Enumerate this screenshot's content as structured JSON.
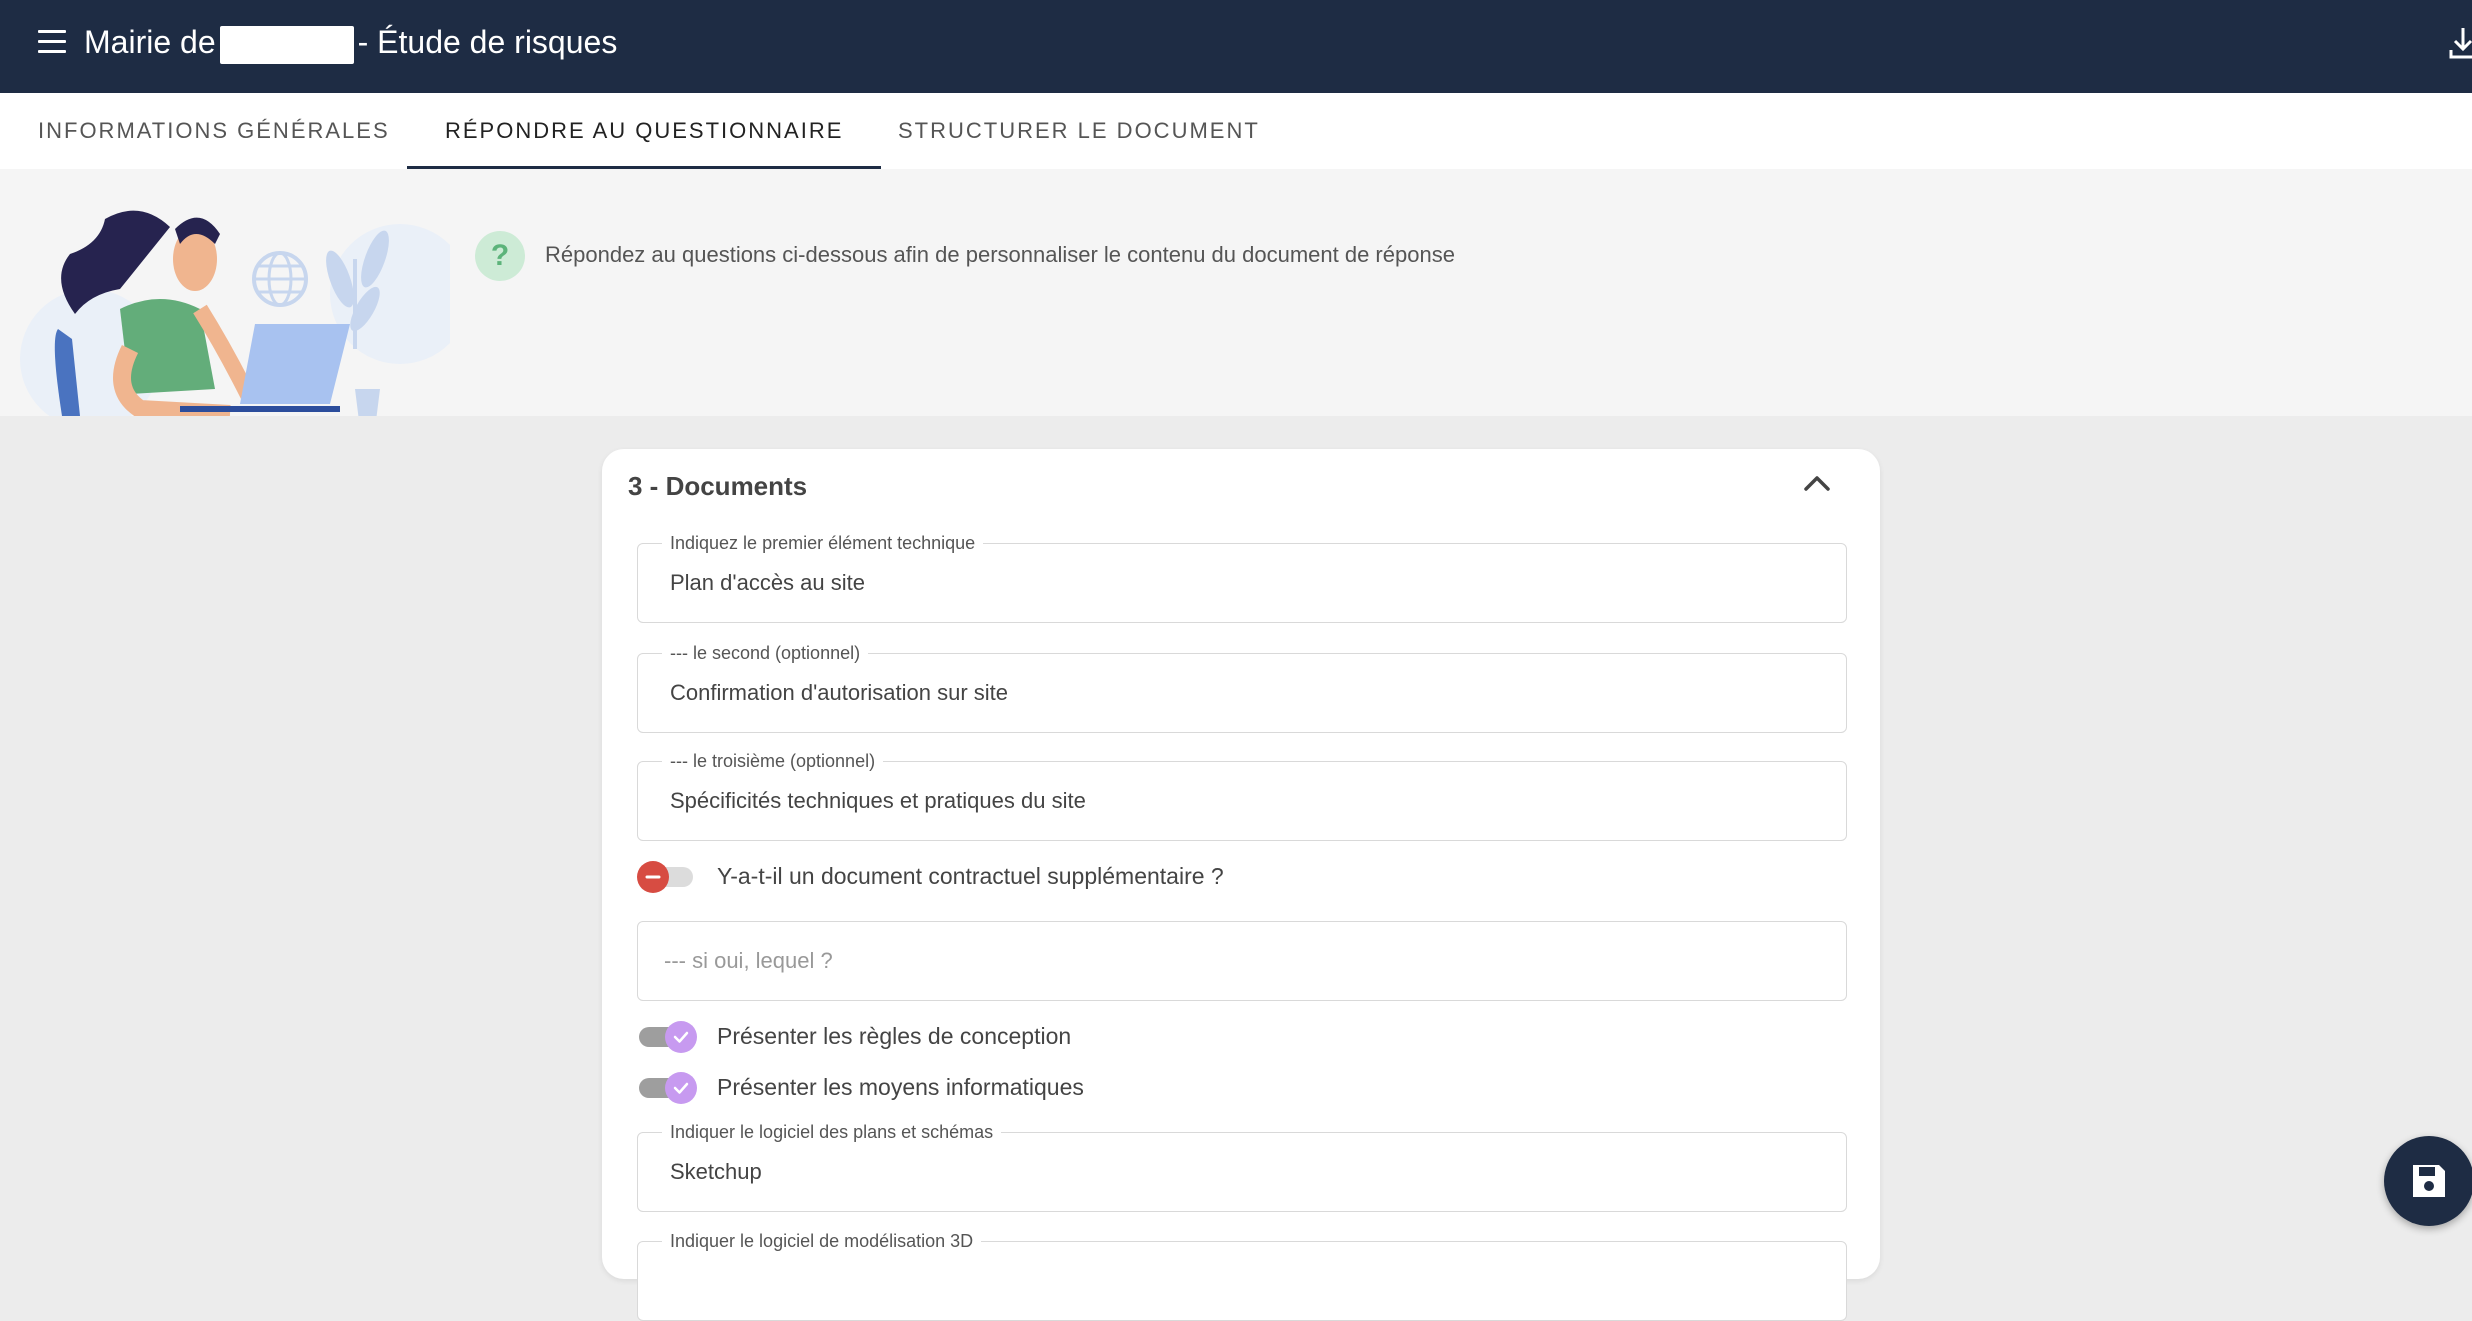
{
  "app": {
    "title_prefix": "Mairie de",
    "title_suffix": "- Étude de risques"
  },
  "tabs": [
    {
      "label": "INFORMATIONS GÉNÉRALES",
      "active": false
    },
    {
      "label": "RÉPONDRE AU QUESTIONNAIRE",
      "active": true
    },
    {
      "label": "STRUCTURER LE DOCUMENT",
      "active": false
    }
  ],
  "banner": {
    "badge": "?",
    "text": "Répondez au questions ci-dessous afin de personnaliser le contenu du document de réponse"
  },
  "section": {
    "title": "3 - Documents",
    "fields": [
      {
        "label": "Indiquez le premier élément technique",
        "value": "Plan d'accès au site"
      },
      {
        "label": "--- le second (optionnel)",
        "value": "Confirmation d'autorisation sur site"
      },
      {
        "label": "--- le troisième (optionnel)",
        "value": "Spécificités techniques et pratiques du site"
      }
    ],
    "toggle_extra_doc": {
      "label": "Y-a-t-il un document contractuel supplémentaire ?",
      "state": "off"
    },
    "extra_doc_input": {
      "placeholder": "--- si oui, lequel ?",
      "value": ""
    },
    "toggle_rules": {
      "label": "Présenter les règles de conception",
      "state": "on"
    },
    "toggle_it": {
      "label": "Présenter les moyens informatiques",
      "state": "on"
    },
    "fields_after": [
      {
        "label": "Indiquer le logiciel des plans et schémas",
        "value": "Sketchup"
      },
      {
        "label": "Indiquer le logiciel de modélisation 3D",
        "value": ""
      }
    ]
  },
  "icons": {
    "menu": "menu-icon",
    "download": "download-icon",
    "help": "question-icon",
    "collapse": "chevron-up-icon",
    "save": "save-icon"
  },
  "colors": {
    "topbar": "#1e2c44",
    "toggle_off": "#d74c42",
    "toggle_on": "#c79af0",
    "help_badge": "#cdebd6"
  }
}
